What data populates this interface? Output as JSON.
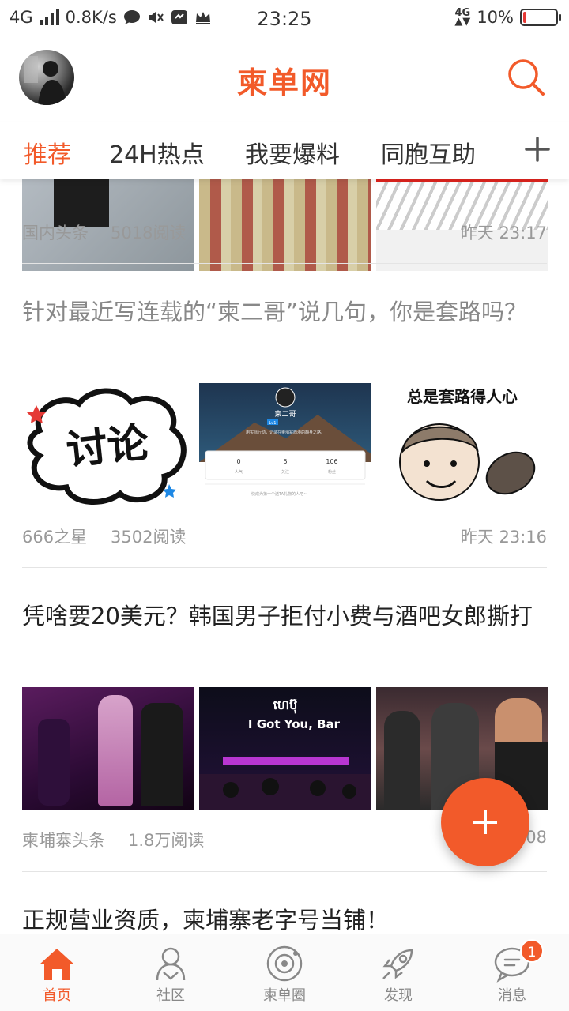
{
  "status_bar": {
    "network": "4G",
    "speed": "0.8K/s",
    "time": "23:25",
    "net_right": "4G",
    "battery": "10%",
    "battery_level": 0.1,
    "battery_color": "#e53935"
  },
  "header": {
    "logo": "柬单网",
    "brand_color": "#f25a2a"
  },
  "tabs": [
    {
      "label": "推荐",
      "active": true
    },
    {
      "label": "24H热点"
    },
    {
      "label": "我要爆料"
    },
    {
      "label": "同胞互助"
    }
  ],
  "feed": [
    {
      "source": "国内头条",
      "reads": "5018阅读",
      "time": "昨天 23:17"
    },
    {
      "title": "针对最近写连载的“柬二哥”说几句，你是套路吗？",
      "source": "666之星",
      "reads": "3502阅读",
      "time": "昨天 23:16",
      "thumb_text": {
        "discuss": "讨论",
        "profile_name": "柬二哥",
        "profile_bio": "用实际行动，记录在柬埔寨西港的翻身之路。",
        "stats": [
          {
            "value": "0",
            "label": "人气"
          },
          {
            "value": "5",
            "label": "关注"
          },
          {
            "value": "106",
            "label": "粉丝"
          }
        ],
        "gift_hint": "快成为第一个送TA礼物的人吧~",
        "meme": "总是套路得人心",
        "profile_level": "Lv1"
      }
    },
    {
      "title": "凭啥要20美元？韩国男子拒付小费与酒吧女郎撕打",
      "source": "柬埔寨头条",
      "reads": "1.8万阅读",
      "time_partial": "08",
      "thumb_text": {
        "bar_sign": "I Got You, Bar"
      }
    },
    {
      "title": "正规营业资质，柬埔寨老字号当铺！"
    }
  ],
  "bottom_nav": [
    {
      "label": "首页",
      "icon": "home-icon",
      "active": true
    },
    {
      "label": "社区",
      "icon": "community-icon"
    },
    {
      "label": "柬单圈",
      "icon": "circle-icon"
    },
    {
      "label": "发现",
      "icon": "rocket-icon"
    },
    {
      "label": "消息",
      "icon": "message-icon",
      "badge": "1"
    }
  ]
}
